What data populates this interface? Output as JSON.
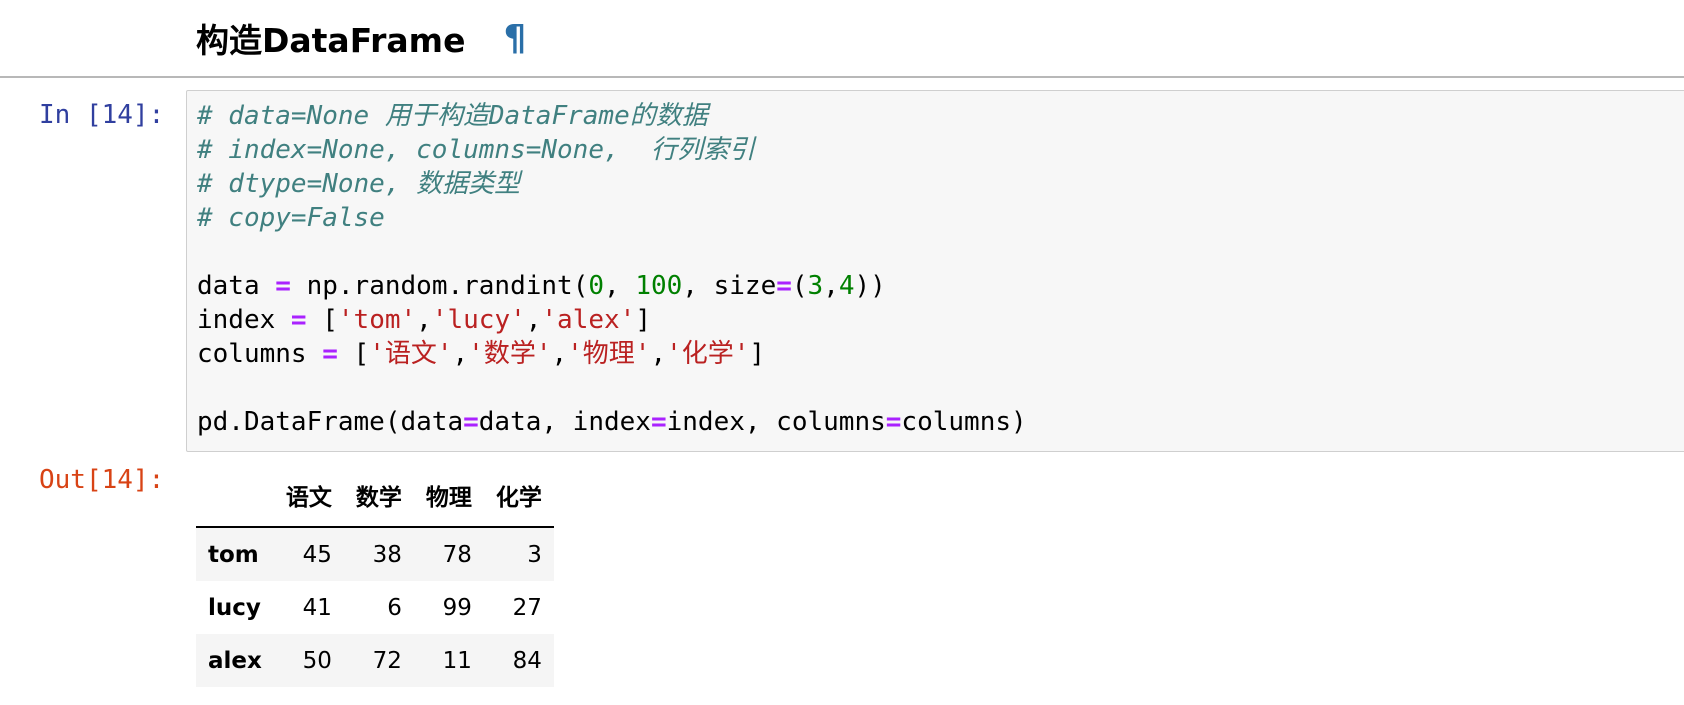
{
  "heading": {
    "title": "构造DataFrame",
    "anchor": "¶"
  },
  "cell": {
    "in_prompt": "In [14]:",
    "out_prompt": "Out[14]:",
    "code_lines": [
      "# data=None 用于构造DataFrame的数据",
      "# index=None, columns=None,  行列索引",
      "# dtype=None, 数据类型",
      "# copy=False",
      "",
      "data = np.random.randint(0, 100, size=(3,4))",
      "index = ['tom','lucy','alex']",
      "columns = ['语文','数学','物理','化学']",
      "",
      "pd.DataFrame(data=data, index=index, columns=columns)"
    ]
  },
  "output": {
    "columns": [
      "语文",
      "数学",
      "物理",
      "化学"
    ],
    "rows": [
      {
        "index": "tom",
        "values": [
          "45",
          "38",
          "78",
          "3"
        ]
      },
      {
        "index": "lucy",
        "values": [
          "41",
          "6",
          "99",
          "27"
        ]
      },
      {
        "index": "alex",
        "values": [
          "50",
          "72",
          "11",
          "84"
        ]
      }
    ]
  },
  "colors": {
    "comment": "#408080",
    "operator": "#aa22ff",
    "number": "#008000",
    "string": "#ba2121",
    "in_prompt": "#303f9f",
    "out_prompt": "#d84315",
    "anchor": "#2a6fa8"
  }
}
